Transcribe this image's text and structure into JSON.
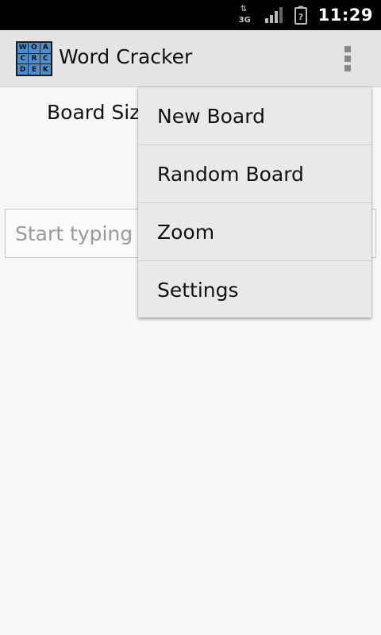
{
  "status_bar": {
    "network_type": "3G",
    "time": "11:29",
    "icons": [
      "data-arrows-icon",
      "signal-icon",
      "battery-unknown-icon"
    ]
  },
  "action_bar": {
    "logo_letters": [
      "W",
      "O",
      "A",
      "C",
      "R",
      "C",
      "D",
      "E",
      "K"
    ],
    "title": "Word Cracker",
    "overflow_icon": "overflow-menu-icon"
  },
  "content": {
    "board_size_label": "Board Size",
    "input_placeholder": "Start typing h"
  },
  "menu": {
    "items": [
      {
        "label": "New Board"
      },
      {
        "label": "Random Board"
      },
      {
        "label": "Zoom"
      },
      {
        "label": "Settings"
      }
    ]
  },
  "colors": {
    "status_bar": "#000000",
    "action_bar": "#e4e4e4",
    "background": "#f7f7f7",
    "menu_background": "#e9e9e9",
    "logo_tile": "#4a8fd0"
  }
}
